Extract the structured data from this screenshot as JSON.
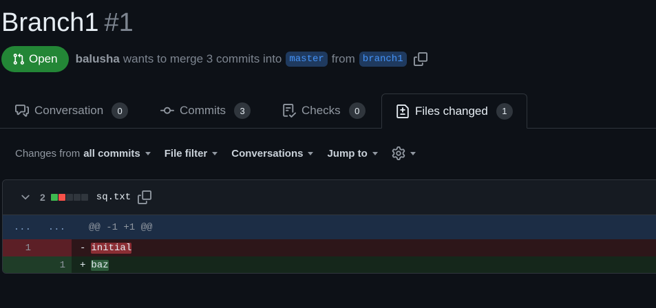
{
  "pr": {
    "title": "Branch1",
    "number": "#1",
    "state": "Open",
    "author": "balusha",
    "merge_text": "wants to merge 3 commits into",
    "base_branch": "master",
    "from_text": "from",
    "head_branch": "branch1"
  },
  "tabs": [
    {
      "label": "Conversation",
      "count": "0",
      "icon": "comment-discussion-icon"
    },
    {
      "label": "Commits",
      "count": "3",
      "icon": "git-commit-icon"
    },
    {
      "label": "Checks",
      "count": "0",
      "icon": "checklist-icon"
    },
    {
      "label": "Files changed",
      "count": "1",
      "icon": "file-diff-icon",
      "active": true
    }
  ],
  "toolbar": {
    "changes_prefix": "Changes from",
    "changes_value": "all commits",
    "file_filter": "File filter",
    "conversations": "Conversations",
    "jump_to": "Jump to"
  },
  "file": {
    "change_count": "2",
    "name": "sq.txt",
    "diffstat": [
      "added",
      "deleted",
      "neutral",
      "neutral",
      "neutral"
    ],
    "hunk": {
      "old_marker": "...",
      "new_marker": "...",
      "header": "@@ -1 +1 @@"
    },
    "lines": [
      {
        "type": "del",
        "old": "1",
        "new": "",
        "sign": "-",
        "text": "initial"
      },
      {
        "type": "add",
        "old": "",
        "new": "1",
        "sign": "+",
        "text": "baz"
      }
    ]
  },
  "colors": {
    "open_badge": "#238636",
    "branch_bg": "#1f3a5f",
    "branch_fg": "#4493f8",
    "add": "#3fb950",
    "del": "#f85149",
    "neutral": "#30363d"
  }
}
